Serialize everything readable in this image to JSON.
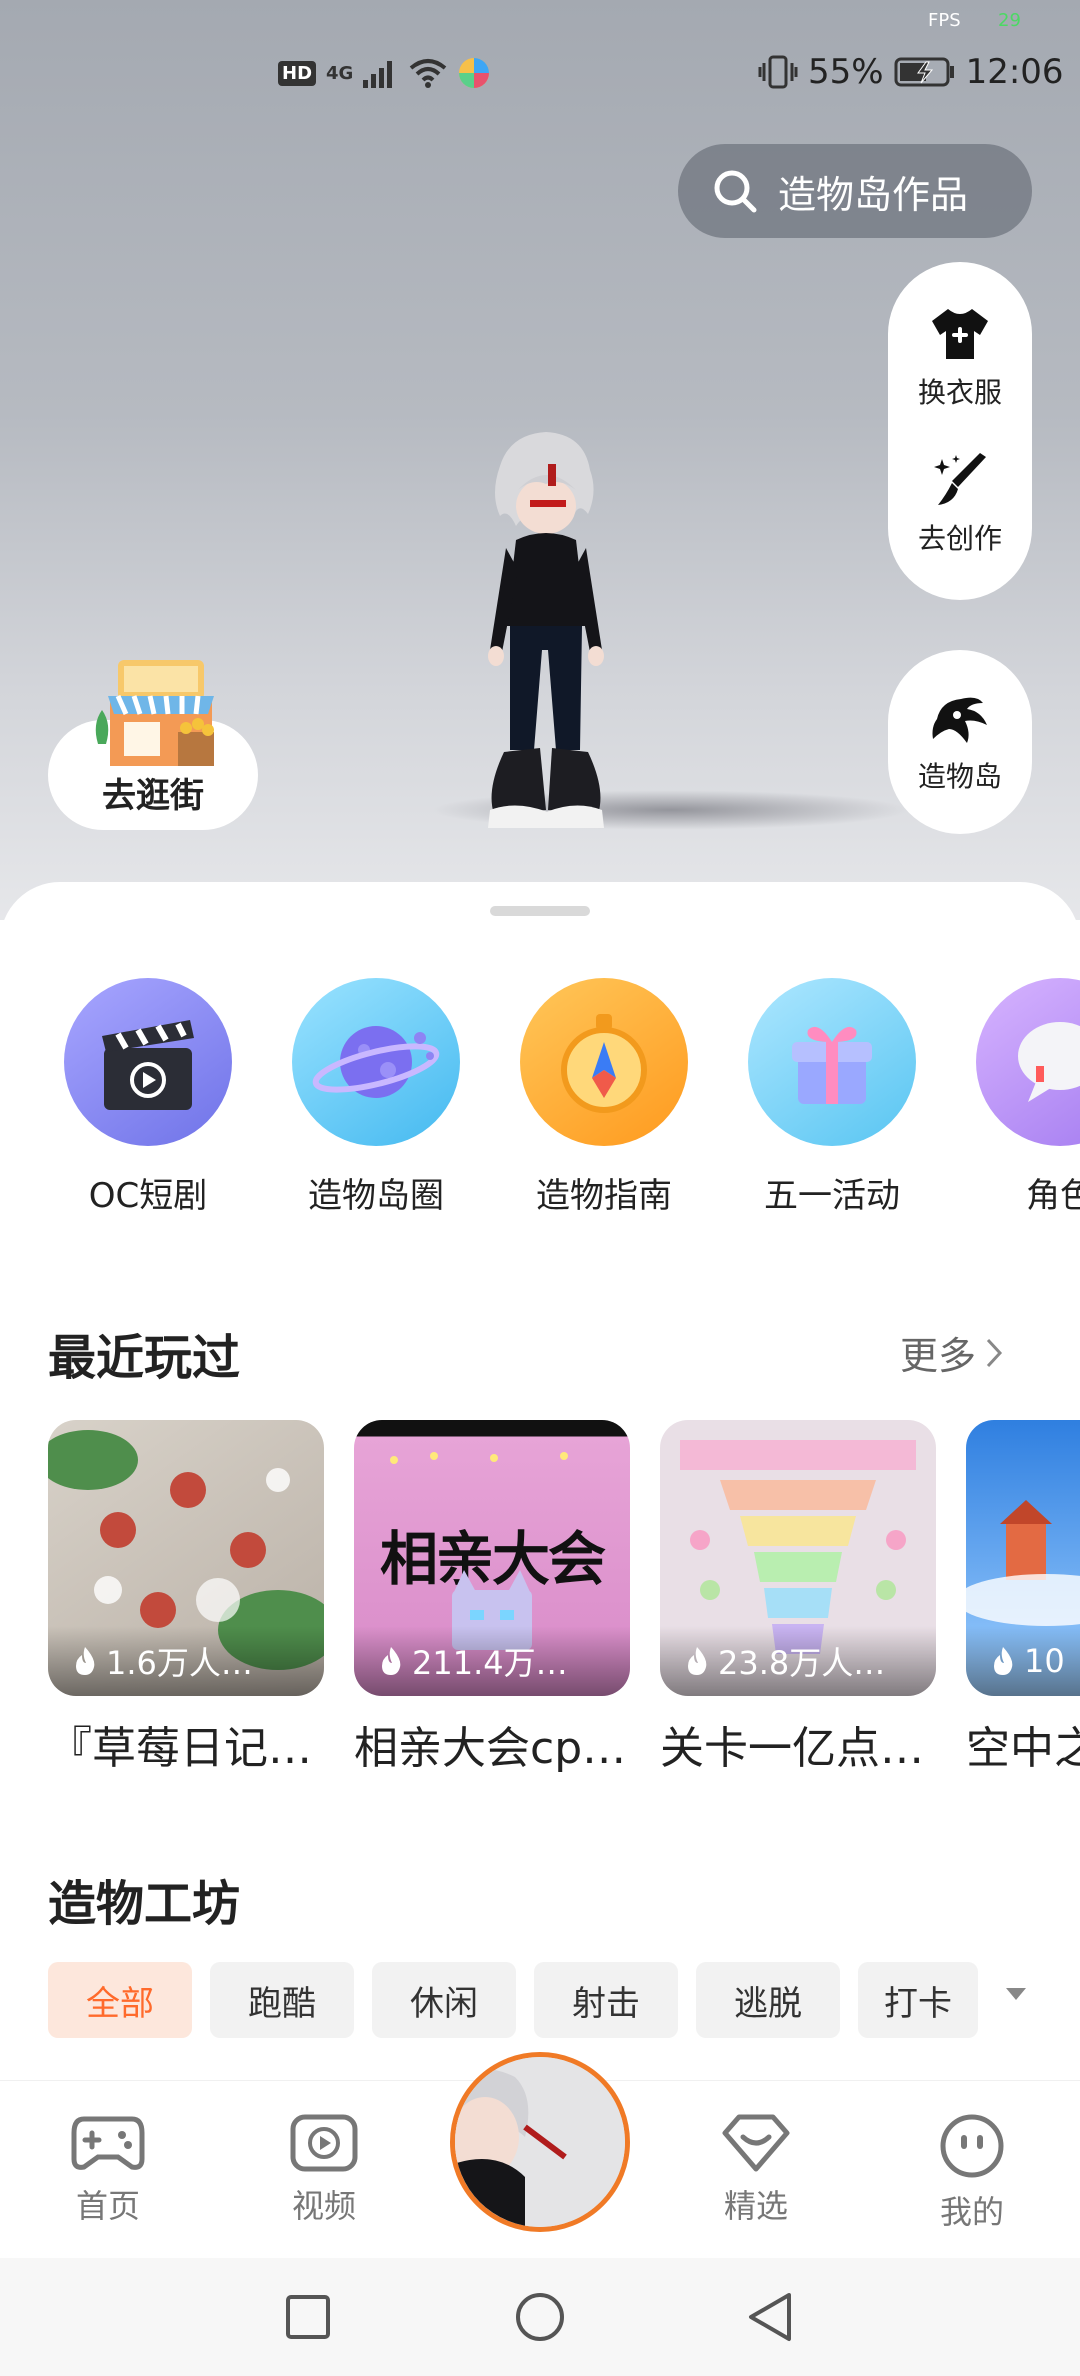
{
  "status_bar": {
    "fps_label": "FPS",
    "fps_value": "29",
    "hd_label": "HD",
    "network": "4G",
    "battery": "55%",
    "time": "12:06"
  },
  "search": {
    "label": "造物岛作品"
  },
  "tools": {
    "change_clothes": "换衣服",
    "create": "去创作",
    "island": "造物岛",
    "street": "去逛街"
  },
  "quick_entries": [
    {
      "label": "OC短剧",
      "icon": "clapperboard-icon"
    },
    {
      "label": "造物岛圈",
      "icon": "planet-icon"
    },
    {
      "label": "造物指南",
      "icon": "compass-icon"
    },
    {
      "label": "五一活动",
      "icon": "gift-icon"
    },
    {
      "label": "角色",
      "icon": "chat-bubble-icon"
    }
  ],
  "recent": {
    "title": "最近玩过",
    "more_label": "更多",
    "games": [
      {
        "name": "『草莓日记…",
        "plays": "1.6万人…"
      },
      {
        "name": "相亲大会cp…",
        "plays": "211.4万…",
        "banner": "相亲大会"
      },
      {
        "name": "关卡一亿点…",
        "plays": "23.8万人…"
      },
      {
        "name": "空中之",
        "plays": "10"
      }
    ]
  },
  "workshop": {
    "title": "造物工坊",
    "filters": [
      "全部",
      "跑酷",
      "休闲",
      "射击",
      "逃脱",
      "打卡"
    ],
    "active_filter": "全部"
  },
  "tab_bar": {
    "home": "首页",
    "video": "视频",
    "featured": "精选",
    "mine": "我的"
  },
  "colors": {
    "accent": "#ff6a2b",
    "avatar_ring": "#f07a26"
  }
}
